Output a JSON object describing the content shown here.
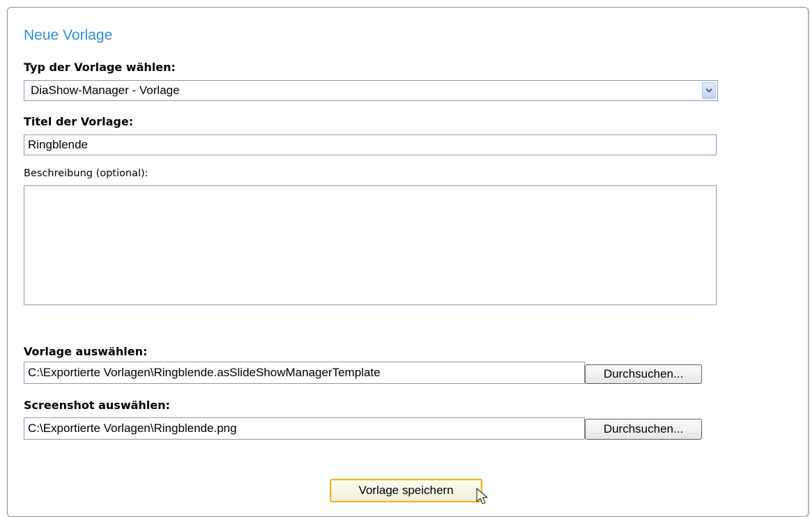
{
  "form": {
    "title": "Neue Vorlage",
    "type_label": "Typ der Vorlage wählen:",
    "type_selected": "DiaShow-Manager - Vorlage",
    "title_label": "Titel der Vorlage:",
    "title_value": "Ringblende",
    "description_label": "Beschreibung (optional):",
    "description_value": "",
    "template_label": "Vorlage auswählen:",
    "template_path": "C:\\Exportierte Vorlagen\\Ringblende.asSlideShowManagerTemplate",
    "screenshot_label": "Screenshot auswählen:",
    "screenshot_path": "C:\\Exportierte Vorlagen\\Ringblende.png",
    "browse_label": "Durchsuchen...",
    "save_label": "Vorlage speichern"
  },
  "colors": {
    "title": "#2f8fd4",
    "field_border": "#7f9db9",
    "save_border": "#e9b628"
  },
  "icons": {
    "dropdown": "chevron-down-icon",
    "cursor": "hand-pointer-icon"
  }
}
